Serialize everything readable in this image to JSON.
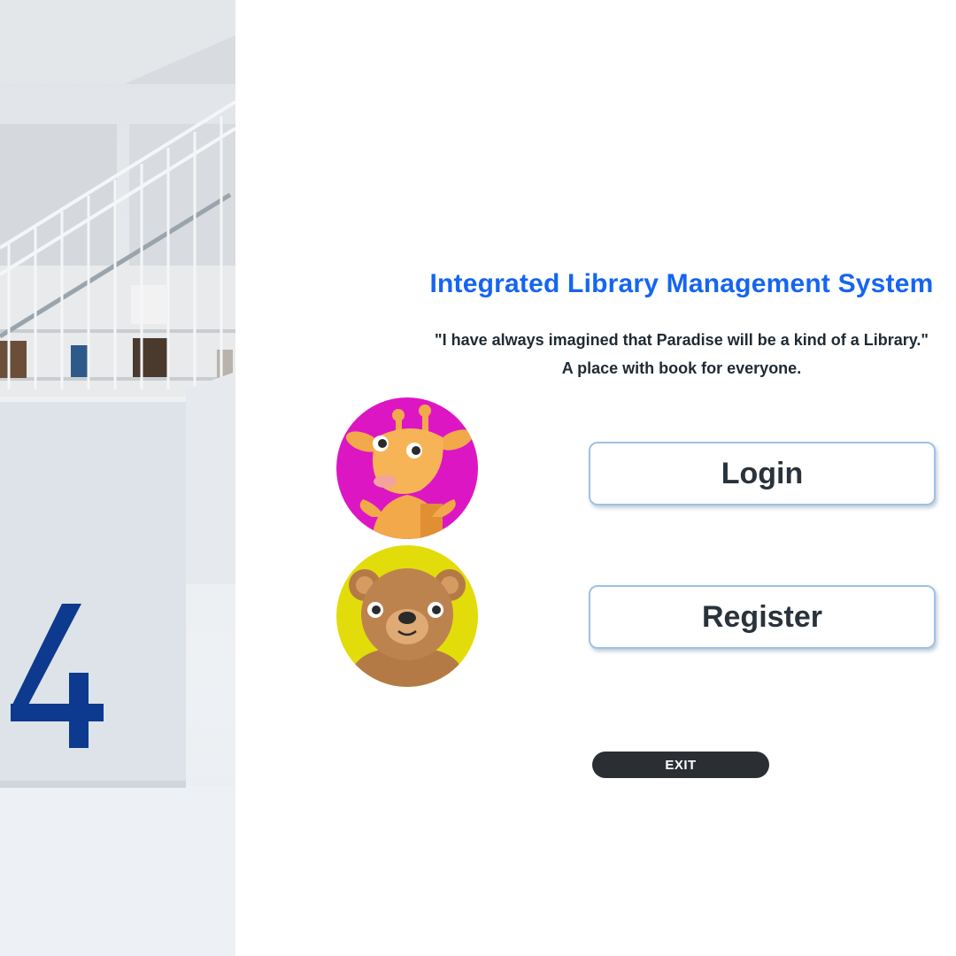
{
  "app": {
    "title": "Integrated Library Management System",
    "quote_line1": "\"I have always imagined that Paradise will be a kind of a Library.\"",
    "quote_line2": "A place with book for everyone."
  },
  "photo": {
    "description_icon": "library-staircase-photo",
    "wall_number": "4"
  },
  "avatars": [
    {
      "icon": "giraffe-icon",
      "background": "#dd16c3"
    },
    {
      "icon": "bear-icon",
      "background": "#e3dc0b"
    }
  ],
  "buttons": {
    "login_label": "Login",
    "register_label": "Register",
    "exit_label": "EXIT"
  },
  "colors": {
    "title": "#1565f0",
    "button_border": "#9cc2e6",
    "exit_bg": "#2b2f33"
  }
}
